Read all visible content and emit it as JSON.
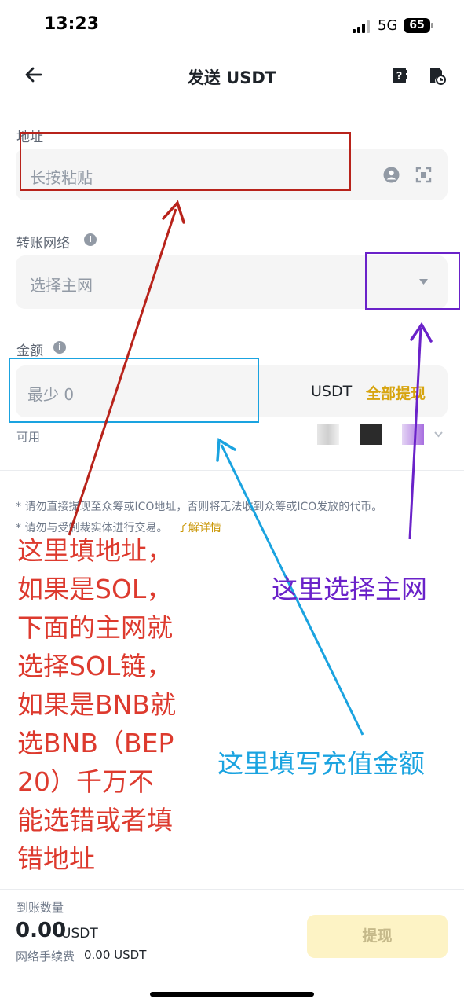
{
  "status_bar": {
    "time": "13:23",
    "network": "5G",
    "battery": "65"
  },
  "header": {
    "title": "发送 USDT",
    "icons": [
      "back-arrow-icon",
      "address-book-icon",
      "history-icon"
    ]
  },
  "address": {
    "label": "地址",
    "placeholder": "长按粘贴",
    "icons": [
      "contact-icon",
      "scan-icon"
    ]
  },
  "network": {
    "label": "转账网络",
    "placeholder": "选择主网"
  },
  "amount": {
    "label": "金额",
    "placeholder": "最少 0",
    "unit": "USDT",
    "withdraw_all": "全部提现",
    "available_label": "可用"
  },
  "notes": {
    "note1": "* 请勿直接提现至众筹或ICO地址，否则将无法收到众筹或ICO发放的代币。",
    "note2": "* 请勿与受制裁实体进行交易。",
    "learn_more": "了解详情"
  },
  "annotations": {
    "red_lines": [
      "这里填地址，",
      "如果是SOL，",
      "下面的主网就",
      "选择SOL链，",
      "如果是BNB就",
      "选BNB（BEP",
      "20）千万不",
      "能选错或者填",
      "错地址"
    ],
    "purple": "这里选择主网",
    "blue": "这里填写充值金额",
    "colors": {
      "red": "#b8231b",
      "purple": "#6a22c9",
      "blue": "#1aa3e0"
    }
  },
  "bottom": {
    "receive_label": "到账数量",
    "receive_amount": "0.00",
    "receive_unit": "USDT",
    "fee_label": "网络手续费",
    "fee_value": "0.00 USDT",
    "submit": "提现"
  }
}
